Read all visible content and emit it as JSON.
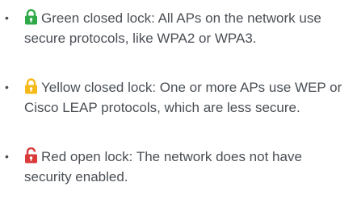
{
  "items": [
    {
      "bullet": "•",
      "icon": "green-closed-lock-icon",
      "color": "#2eaa48",
      "text": "Green closed lock: All APs on the network use secure protocols, like WPA2 or WPA3."
    },
    {
      "bullet": "•",
      "icon": "yellow-closed-lock-icon",
      "color": "#f5b91a",
      "text": "Yellow closed lock: One or more APs use WEP or Cisco LEAP protocols, which are less secure."
    },
    {
      "bullet": "•",
      "icon": "red-open-lock-icon",
      "color": "#d93a3a",
      "text": "Red open lock: The network does not have security enabled."
    }
  ]
}
